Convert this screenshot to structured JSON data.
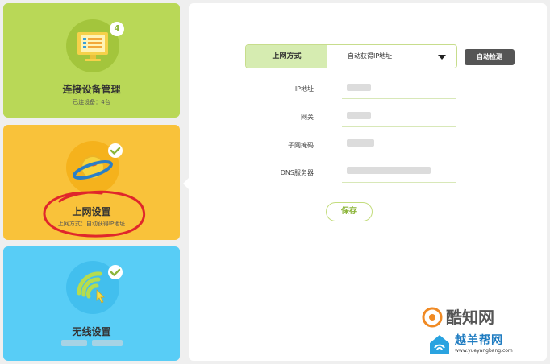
{
  "sidebar": {
    "devices": {
      "title": "连接设备管理",
      "subtitle": "已连设备：4台",
      "badge": "4",
      "icon": "monitor-icon"
    },
    "internet": {
      "title": "上网设置",
      "subtitle": "上网方式：自动获得IP地址",
      "badge_icon": "check-icon",
      "icon": "globe-planet-icon"
    },
    "wireless": {
      "title": "无线设置",
      "badge_icon": "check-icon",
      "icon": "wifi-icon"
    }
  },
  "form": {
    "connection_type_label": "上网方式",
    "connection_type_value": "自动获得IP地址",
    "detect_button": "自动检测",
    "fields": [
      {
        "label": "IP地址"
      },
      {
        "label": "网关"
      },
      {
        "label": "子网掩码"
      },
      {
        "label": "DNS服务器"
      }
    ],
    "save_button": "保存"
  },
  "watermarks": {
    "kuzhi": "酷知网",
    "yueyang": "越羊帮网",
    "yueyang_url": "www.yueyangbang.com"
  },
  "colors": {
    "devices_tile": "#b9d857",
    "internet_tile": "#f9c23a",
    "wireless_tile": "#58cdf6",
    "accent_green": "#8cb53a",
    "annotation_red": "#e0262b"
  }
}
